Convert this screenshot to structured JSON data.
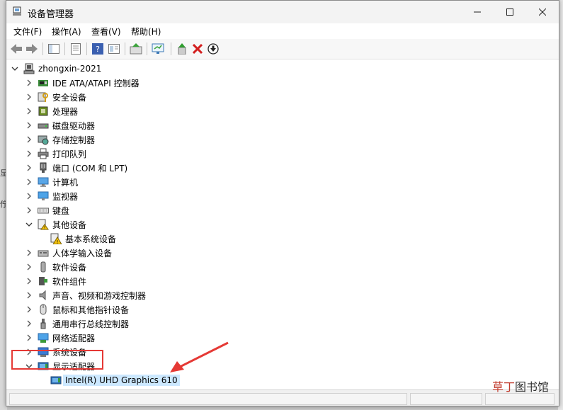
{
  "window": {
    "title": "设备管理器"
  },
  "menu": [
    "文件(F)",
    "操作(A)",
    "查看(V)",
    "帮助(H)"
  ],
  "toolbar_icons": [
    "back-arrow-icon",
    "forward-arrow-icon",
    "show-hide-tree-icon",
    "properties-icon",
    "help-icon",
    "view-icon",
    "update-driver-icon",
    "scan-hardware-icon",
    "enable-device-icon",
    "uninstall-device-icon",
    "disable-device-icon"
  ],
  "tree": {
    "root": "zhongxin-2021",
    "categories": [
      {
        "label": "IDE ATA/ATAPI 控制器",
        "icon": "ide-controller-icon",
        "expanded": false
      },
      {
        "label": "安全设备",
        "icon": "security-device-icon",
        "expanded": false
      },
      {
        "label": "处理器",
        "icon": "processor-icon",
        "expanded": false
      },
      {
        "label": "磁盘驱动器",
        "icon": "disk-drive-icon",
        "expanded": false
      },
      {
        "label": "存储控制器",
        "icon": "storage-controller-icon",
        "expanded": false
      },
      {
        "label": "打印队列",
        "icon": "printer-icon",
        "expanded": false
      },
      {
        "label": "端口 (COM 和 LPT)",
        "icon": "port-icon",
        "expanded": false
      },
      {
        "label": "计算机",
        "icon": "computer-icon",
        "expanded": false
      },
      {
        "label": "监视器",
        "icon": "monitor-icon",
        "expanded": false
      },
      {
        "label": "键盘",
        "icon": "keyboard-icon",
        "expanded": false
      },
      {
        "label": "其他设备",
        "icon": "other-devices-icon",
        "expanded": true,
        "children": [
          {
            "label": "基本系统设备",
            "icon": "warning-device-icon"
          }
        ]
      },
      {
        "label": "人体学输入设备",
        "icon": "hid-icon",
        "expanded": false
      },
      {
        "label": "软件设备",
        "icon": "software-device-icon",
        "expanded": false
      },
      {
        "label": "软件组件",
        "icon": "software-component-icon",
        "expanded": false
      },
      {
        "label": "声音、视频和游戏控制器",
        "icon": "speaker-icon",
        "expanded": false
      },
      {
        "label": "鼠标和其他指针设备",
        "icon": "mouse-icon",
        "expanded": false
      },
      {
        "label": "通用串行总线控制器",
        "icon": "usb-icon",
        "expanded": false
      },
      {
        "label": "网络适配器",
        "icon": "network-adapter-icon",
        "expanded": false
      },
      {
        "label": "系统设备",
        "icon": "system-device-icon",
        "expanded": false
      },
      {
        "label": "显示适配器",
        "icon": "display-adapter-icon",
        "expanded": true,
        "children": [
          {
            "label": "Intel(R) UHD Graphics 610",
            "icon": "display-adapter-icon",
            "selected": true
          }
        ]
      }
    ]
  },
  "backdrop": {
    "glyph_1": "显",
    "glyph_2": "佇"
  },
  "watermark": {
    "accent": "草丁",
    "main": "图书馆"
  },
  "colors": {
    "selection": "#cce8ff",
    "annotation": "#e53935"
  }
}
